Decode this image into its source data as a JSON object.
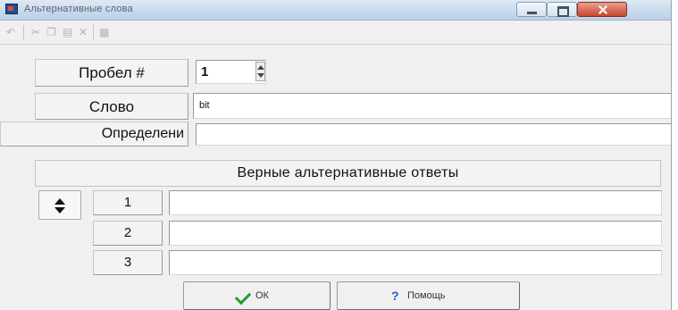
{
  "window": {
    "title": "Альтернативные слова"
  },
  "toolbar": {
    "icons": [
      "undo-icon",
      "cut-icon",
      "copy-icon",
      "paste-icon",
      "delete-icon",
      "grid-icon"
    ]
  },
  "form": {
    "blank_label": "Пробел #",
    "blank_value": "1",
    "word_label": "Слово",
    "word_value": "bit",
    "definition_label": "Определени",
    "definition_value": ""
  },
  "alternatives": {
    "header": "Верные альтернативные ответы",
    "rows": [
      {
        "number": "1",
        "value": ""
      },
      {
        "number": "2",
        "value": ""
      },
      {
        "number": "3",
        "value": ""
      }
    ]
  },
  "buttons": {
    "ok_label": "ОК",
    "help_label": "Помощь"
  },
  "colors": {
    "title_bar": "#c9d9ec",
    "close_button": "#c9452e",
    "ok_check": "#2a9b2a",
    "help_icon": "#1a63c8"
  }
}
